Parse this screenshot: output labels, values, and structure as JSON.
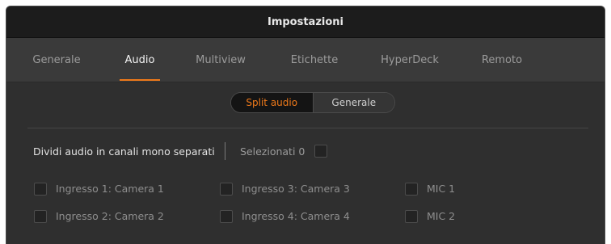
{
  "window": {
    "title": "Impostazioni"
  },
  "tabs": [
    {
      "label": "Generale",
      "active": false
    },
    {
      "label": "Audio",
      "active": true
    },
    {
      "label": "Multiview",
      "active": false
    },
    {
      "label": "Etichette",
      "active": false
    },
    {
      "label": "HyperDeck",
      "active": false
    },
    {
      "label": "Remoto",
      "active": false
    }
  ],
  "segmented": {
    "options": [
      "Split audio",
      "Generale"
    ],
    "selected": "Split audio"
  },
  "split": {
    "label": "Dividi audio in canali mono separati",
    "selected_label": "Selezionati 0",
    "selected_count": 0
  },
  "inputs": [
    {
      "label": "Ingresso 1: Camera 1",
      "checked": false
    },
    {
      "label": "Ingresso 2: Camera 2",
      "checked": false
    },
    {
      "label": "Ingresso 3: Camera 3",
      "checked": false
    },
    {
      "label": "Ingresso 4: Camera 4",
      "checked": false
    },
    {
      "label": "MIC 1",
      "checked": false
    },
    {
      "label": "MIC 2",
      "checked": false
    }
  ],
  "colors": {
    "accent": "#f07a1a",
    "background": "#2f2f2f",
    "titlebar": "#1c1c1c"
  }
}
